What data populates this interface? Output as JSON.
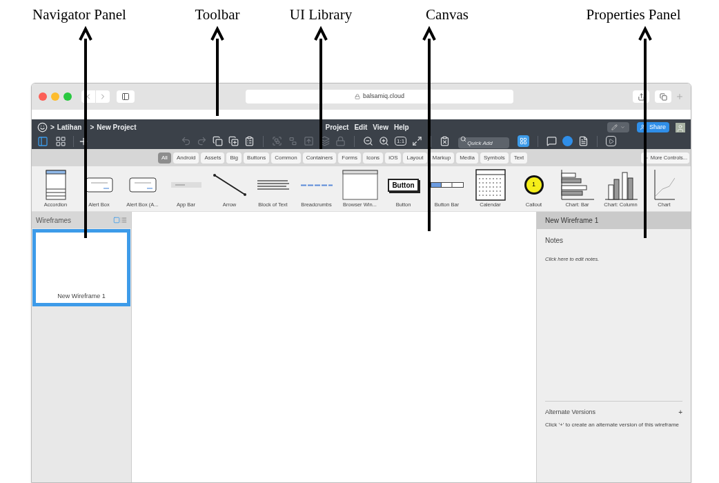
{
  "annotations": [
    {
      "label": "Navigator Panel"
    },
    {
      "label": "Toolbar"
    },
    {
      "label": "UI Library"
    },
    {
      "label": "Canvas"
    },
    {
      "label": "Properties Panel"
    }
  ],
  "browser": {
    "address": "balsamiq.cloud"
  },
  "app": {
    "breadcrumb": {
      "separator": ">",
      "items": [
        "Latihan",
        "New Project"
      ]
    },
    "menu": [
      "Project",
      "Edit",
      "View",
      "Help"
    ],
    "share_label": "Share"
  },
  "toolbar": {
    "view_tools": [
      {
        "kind": "panel",
        "selected": true
      },
      {
        "kind": "grid",
        "selected": false
      }
    ],
    "tools": [
      {
        "kind": "undo",
        "disabled": true
      },
      {
        "kind": "redo",
        "disabled": true
      },
      {
        "kind": "copy",
        "disabled": false
      },
      {
        "kind": "duplicate",
        "disabled": false
      },
      {
        "kind": "paste",
        "disabled": false
      },
      {
        "kind": "separator"
      },
      {
        "kind": "group",
        "disabled": true
      },
      {
        "kind": "ungroup",
        "disabled": true
      },
      {
        "kind": "forward",
        "disabled": true
      },
      {
        "kind": "layers",
        "disabled": true
      },
      {
        "kind": "lock",
        "disabled": true
      },
      {
        "kind": "separator"
      },
      {
        "kind": "zoom-out",
        "disabled": false
      },
      {
        "kind": "zoom-in",
        "disabled": false
      },
      {
        "kind": "actual-size",
        "label": "1:1",
        "disabled": false
      },
      {
        "kind": "fit",
        "disabled": false
      },
      {
        "kind": "separator"
      },
      {
        "kind": "clear",
        "disabled": false
      },
      {
        "kind": "search",
        "placeholder": "Quick Add"
      },
      {
        "kind": "library-toggle",
        "disabled": false
      },
      {
        "kind": "separator"
      },
      {
        "kind": "comment",
        "disabled": false
      },
      {
        "kind": "user",
        "disabled": false
      },
      {
        "kind": "notes",
        "disabled": false
      },
      {
        "kind": "separator"
      },
      {
        "kind": "present",
        "disabled": false
      }
    ]
  },
  "categories": [
    {
      "label": "All",
      "selected": true
    },
    {
      "label": "Android",
      "selected": false
    },
    {
      "label": "Assets",
      "selected": false
    },
    {
      "label": "Big",
      "selected": false
    },
    {
      "label": "Buttons",
      "selected": false
    },
    {
      "label": "Common",
      "selected": false
    },
    {
      "label": "Containers",
      "selected": false
    },
    {
      "label": "Forms",
      "selected": false
    },
    {
      "label": "Icons",
      "selected": false
    },
    {
      "label": "iOS",
      "selected": false
    },
    {
      "label": "Layout",
      "selected": false
    },
    {
      "label": "Markup",
      "selected": false
    },
    {
      "label": "Media",
      "selected": false
    },
    {
      "label": "Symbols",
      "selected": false
    },
    {
      "label": "Text",
      "selected": false
    }
  ],
  "more_controls": {
    "label": "More Controls..."
  },
  "library": [
    {
      "label": "Accordion",
      "kind": "accordion"
    },
    {
      "label": "Alert Box",
      "kind": "alert"
    },
    {
      "label": "Alert Box (A...",
      "kind": "alert"
    },
    {
      "label": "App Bar",
      "kind": "appbar"
    },
    {
      "label": "Arrow",
      "kind": "arrow"
    },
    {
      "label": "Block of Text",
      "kind": "text"
    },
    {
      "label": "Breadcrumbs",
      "kind": "breadcrumbs"
    },
    {
      "label": "Browser Win...",
      "kind": "browser"
    },
    {
      "label": "Button",
      "kind": "button",
      "text": "Button"
    },
    {
      "label": "Button Bar",
      "kind": "buttonbar"
    },
    {
      "label": "Calendar",
      "kind": "calendar"
    },
    {
      "label": "Callout",
      "kind": "callout",
      "text": "1"
    },
    {
      "label": "Chart: Bar",
      "kind": "barchart"
    },
    {
      "label": "Chart: Column",
      "kind": "columnchart"
    },
    {
      "label": "Chart",
      "kind": "linechart"
    }
  ],
  "navigator": {
    "title": "Wireframes",
    "view_icons": [
      {
        "kind": "thumbnails",
        "selected": true
      },
      {
        "kind": "list",
        "selected": false
      }
    ],
    "pages": [
      {
        "label": "New Wireframe 1",
        "selected": true
      }
    ]
  },
  "properties": {
    "title": "New Wireframe 1",
    "notes_title": "Notes",
    "notes_placeholder": "Click here to edit notes.",
    "alternates_title": "Alternate Versions",
    "alternates_add": "+",
    "alternates_hint": "Click '+' to create an alternate version of this wireframe"
  }
}
